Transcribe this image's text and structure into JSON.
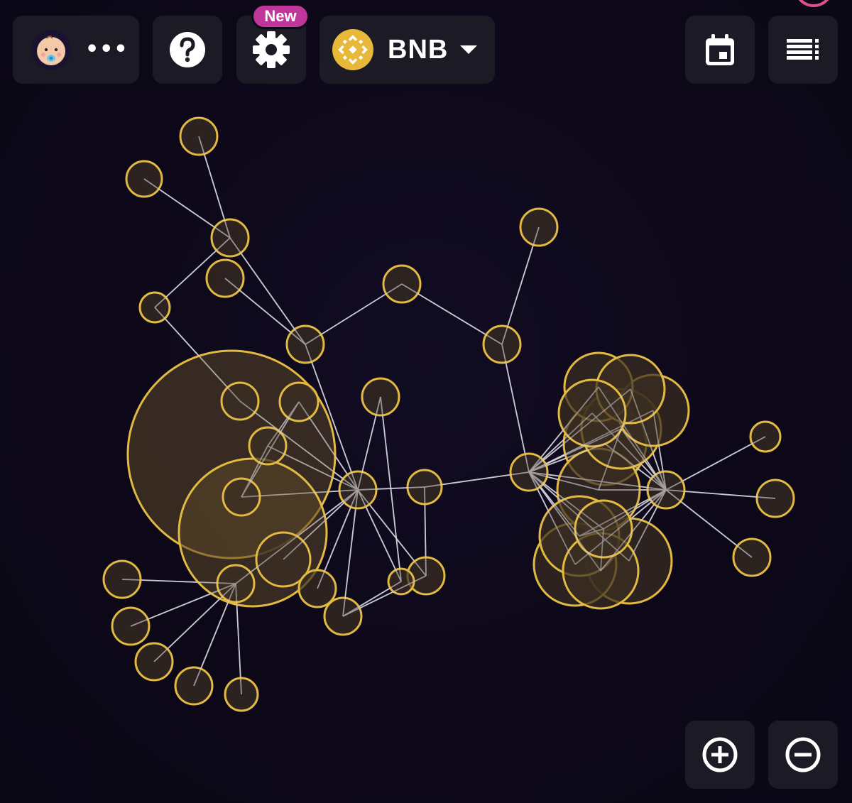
{
  "header": {
    "profile": {
      "avatar_icon": "baby-face-icon",
      "more_label": "•••"
    },
    "help": {
      "icon": "question-circle-icon"
    },
    "settings": {
      "icon": "gear-icon",
      "badge_label": "New",
      "badge_color": "#c0369a"
    },
    "chain_selector": {
      "icon": "bnb-logo-icon",
      "label": "BNB",
      "caret_icon": "caret-down-icon",
      "logo_color": "#f0b90b"
    },
    "calendar": {
      "icon": "calendar-icon"
    },
    "list": {
      "icon": "list-icon"
    }
  },
  "zoom": {
    "zoom_in_icon": "plus-circle-icon",
    "zoom_out_icon": "minus-circle-icon"
  },
  "colors": {
    "background": "#0c0818",
    "node_stroke": "#e2b941",
    "node_fill": "#3a2d22",
    "edge": "#d8d8e0",
    "button_bg": "#1c1a24",
    "accent_pink": "#e0508c"
  }
}
